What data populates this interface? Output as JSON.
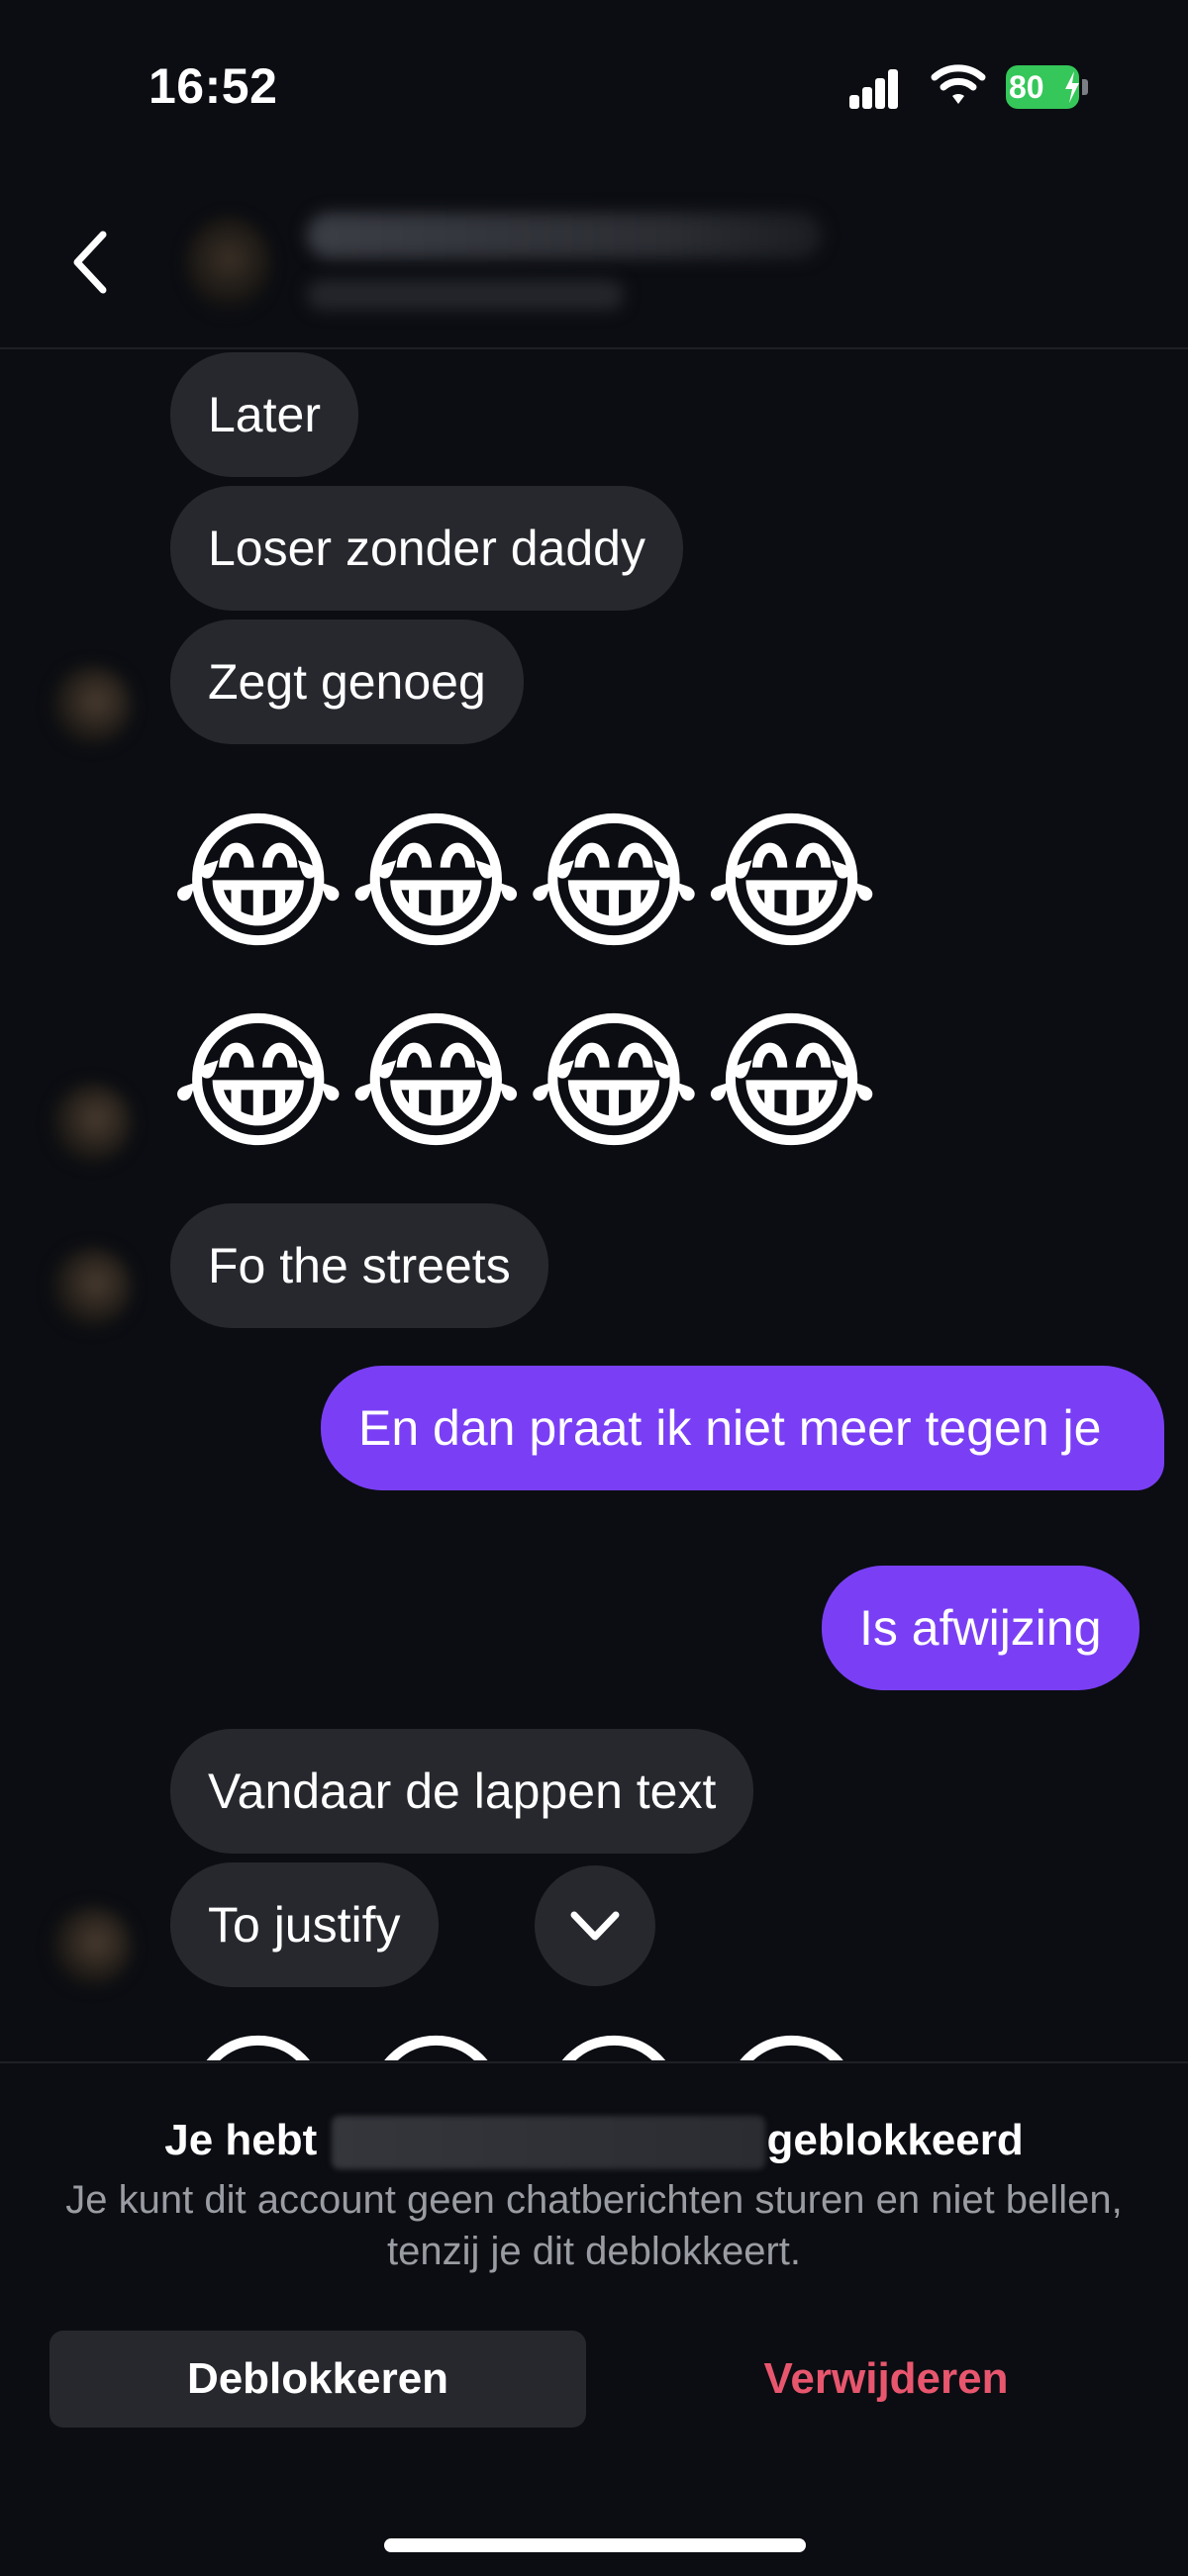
{
  "status_bar": {
    "time": "16:52",
    "battery_level": "80",
    "battery_color": "#35c759"
  },
  "header": {
    "back_icon": "chevron-left-icon"
  },
  "messages": [
    {
      "direction": "incoming",
      "text": "Later"
    },
    {
      "direction": "incoming",
      "text": "Loser zonder daddy"
    },
    {
      "direction": "incoming",
      "text": "Zegt genoeg"
    },
    {
      "direction": "incoming",
      "text": "😂😂😂😂"
    },
    {
      "direction": "incoming",
      "text": "😂😂😂😂"
    },
    {
      "direction": "incoming",
      "text": "Fo the streets"
    },
    {
      "direction": "outgoing",
      "text": "En dan praat ik niet meer tegen je"
    },
    {
      "direction": "outgoing",
      "text": "Is afwijzing"
    },
    {
      "direction": "incoming",
      "text": "Vandaar de lappen text"
    },
    {
      "direction": "incoming",
      "text": "To justify"
    },
    {
      "direction": "incoming",
      "text": "😂😂😂😂"
    }
  ],
  "scroll_down_icon": "chevron-down-icon",
  "blocked": {
    "title_prefix": "Je hebt",
    "title_suffix": "geblokkeerd",
    "description": "Je kunt dit account geen chatberichten sturen en niet bellen, tenzij je dit deblokkeert.",
    "unblock_label": "Deblokkeren",
    "delete_label": "Verwijderen",
    "delete_color": "#e8566e"
  },
  "colors": {
    "background": "#0b0d12",
    "incoming_bubble": "#26282e",
    "outgoing_bubble": "#7a3ff5"
  }
}
